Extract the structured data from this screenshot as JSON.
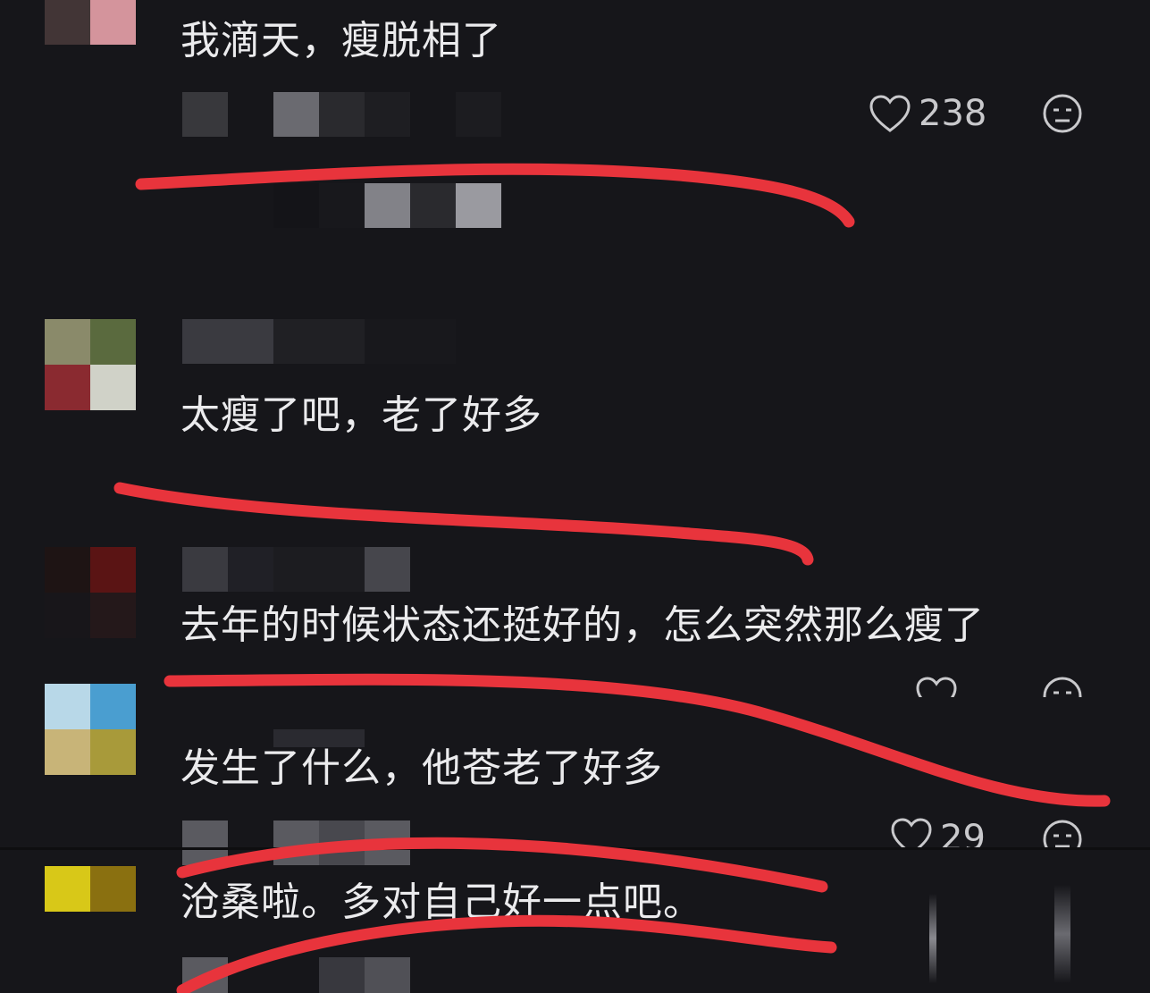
{
  "comments": [
    {
      "text": "我滴天，瘦脱相了",
      "likes": "238"
    },
    {
      "text": "太瘦了吧，老了好多",
      "likes": ""
    },
    {
      "text": "去年的时候状态还挺好的，怎么突然那么瘦了",
      "likes": ""
    },
    {
      "text": "发生了什么，他苍老了好多",
      "likes": "29"
    },
    {
      "text": "沧桑啦。多对自己好一点吧。",
      "likes": ""
    }
  ],
  "icons": {
    "like": "heart-outline-icon",
    "react": "neutral-face-icon"
  },
  "colors": {
    "background": "#16161a",
    "text": "#ebebed",
    "annotation": "#e8343c"
  }
}
